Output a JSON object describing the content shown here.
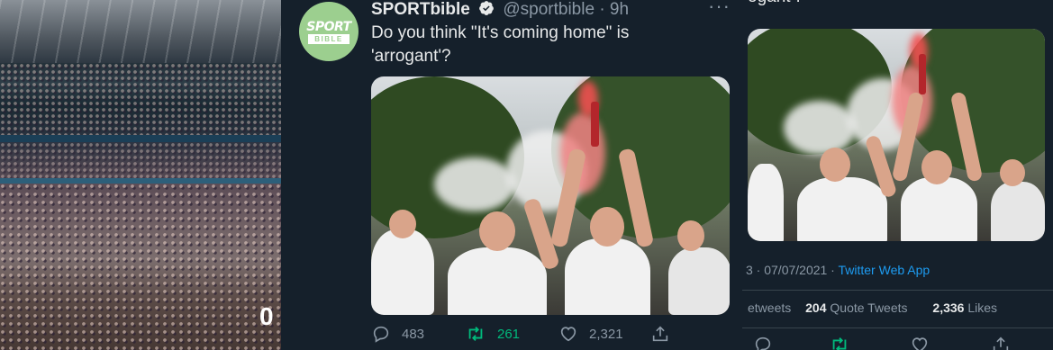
{
  "stadium": {
    "overlay_char": "0"
  },
  "tweet": {
    "account_name": "SPORTbible",
    "handle": "@sportbible",
    "separator": "·",
    "time": "9h",
    "more_label": "···",
    "text_line1": "Do you think \"It's coming home\" is",
    "text_line2": "'arrogant'?",
    "avatar_logo_top": "SPORT",
    "avatar_logo_bottom": "BIBLE",
    "actions": {
      "replies": "483",
      "retweets": "261",
      "likes": "2,321"
    },
    "icons": [
      "verified-icon",
      "reply-icon",
      "retweet-icon",
      "like-icon",
      "share-icon"
    ]
  },
  "detail": {
    "cut_text": "ogant'?",
    "date_prefix": "3 · 07/07/2021 · ",
    "app_name": "Twitter Web App",
    "retweets_label": "etweets",
    "quote_count": "204",
    "quote_label": "Quote Tweets",
    "likes_count": "2,336",
    "likes_label": "Likes"
  },
  "colors": {
    "background": "#15202b",
    "text_primary": "#e7e9ea",
    "text_secondary": "#8b98a5",
    "accent_blue": "#1d9bf0",
    "retweet_green": "#00ba7c",
    "avatar_green": "#9ccf8f"
  }
}
